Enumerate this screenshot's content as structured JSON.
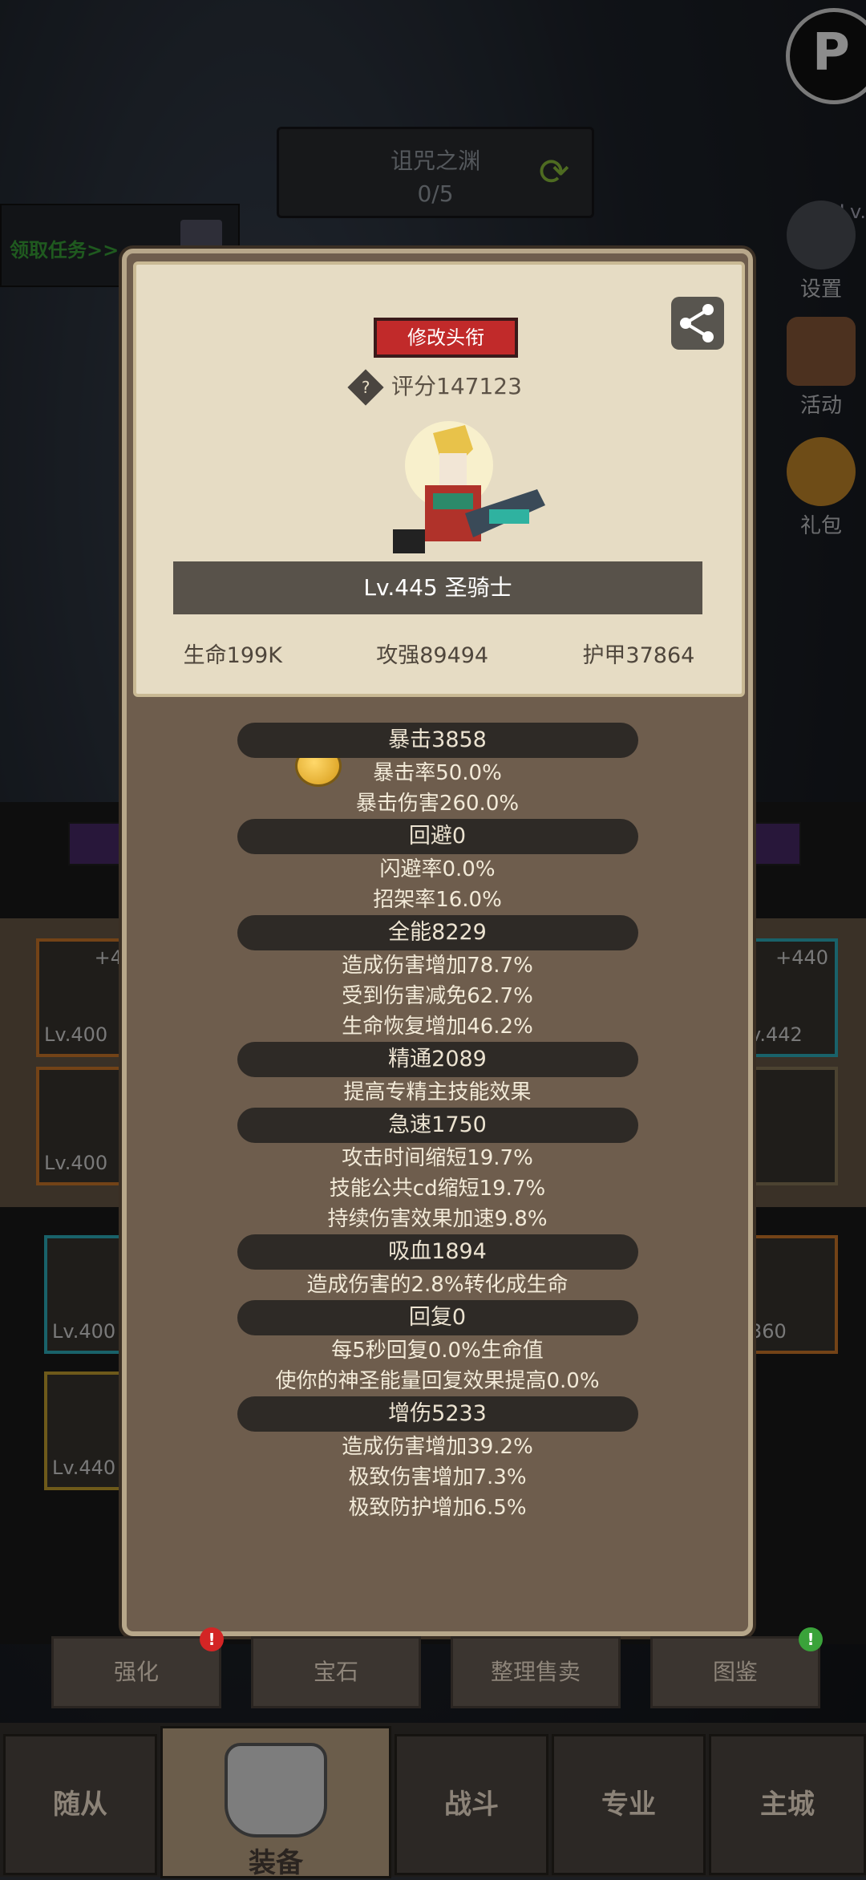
{
  "top": {
    "dungeon_name": "诅咒之渊",
    "dungeon_progress": "0/5",
    "task_tab": "领取任务>>",
    "level_tag": "Lv."
  },
  "side_buttons": [
    {
      "label": "设置",
      "icon": "gear-icon"
    },
    {
      "label": "活动",
      "icon": "calendar-icon"
    },
    {
      "label": "礼包",
      "icon": "gift-icon"
    }
  ],
  "bg_slots": {
    "left_top": {
      "plus": "+4",
      "lv": "Lv.400"
    },
    "left_mid": {
      "lv": "Lv.400"
    },
    "left_low1": {
      "lv": "Lv.400"
    },
    "left_low2": {
      "lv": "Lv.440"
    },
    "right_top": {
      "plus": "+440",
      "lv": "v.442"
    },
    "right_low1": {
      "lv": "360"
    }
  },
  "profile": {
    "title_button": "修改头衔",
    "score": "评分147123",
    "name": "Lv.445 圣骑士",
    "stats": [
      "生命199K",
      "攻强89494",
      "护甲37864"
    ]
  },
  "attributes": [
    {
      "header": "暴击3858",
      "lines": [
        "暴击率50.0%",
        "暴击伤害260.0%"
      ]
    },
    {
      "header": "回避0",
      "lines": [
        "闪避率0.0%",
        "招架率16.0%"
      ]
    },
    {
      "header": "全能8229",
      "lines": [
        "造成伤害增加78.7%",
        "受到伤害减免62.7%",
        "生命恢复增加46.2%"
      ]
    },
    {
      "header": "精通2089",
      "lines": [
        "提高专精主技能效果"
      ]
    },
    {
      "header": "急速1750",
      "lines": [
        "攻击时间缩短19.7%",
        "技能公共cd缩短19.7%",
        "持续伤害效果加速9.8%"
      ]
    },
    {
      "header": "吸血1894",
      "lines": [
        "造成伤害的2.8%转化成生命"
      ]
    },
    {
      "header": "回复0",
      "lines": [
        "每5秒回复0.0%生命值",
        "使你的神圣能量回复效果提高0.0%"
      ]
    },
    {
      "header": "增伤5233",
      "lines": [
        "造成伤害增加39.2%",
        "极致伤害增加7.3%",
        "极致防护增加6.5%"
      ]
    }
  ],
  "actions": [
    {
      "label": "强化",
      "badge": "!"
    },
    {
      "label": "宝石"
    },
    {
      "label": "整理售卖"
    },
    {
      "label": "图鉴",
      "badge": "!"
    }
  ],
  "nav": [
    "随从",
    "装备",
    "战斗",
    "专业",
    "主城"
  ]
}
